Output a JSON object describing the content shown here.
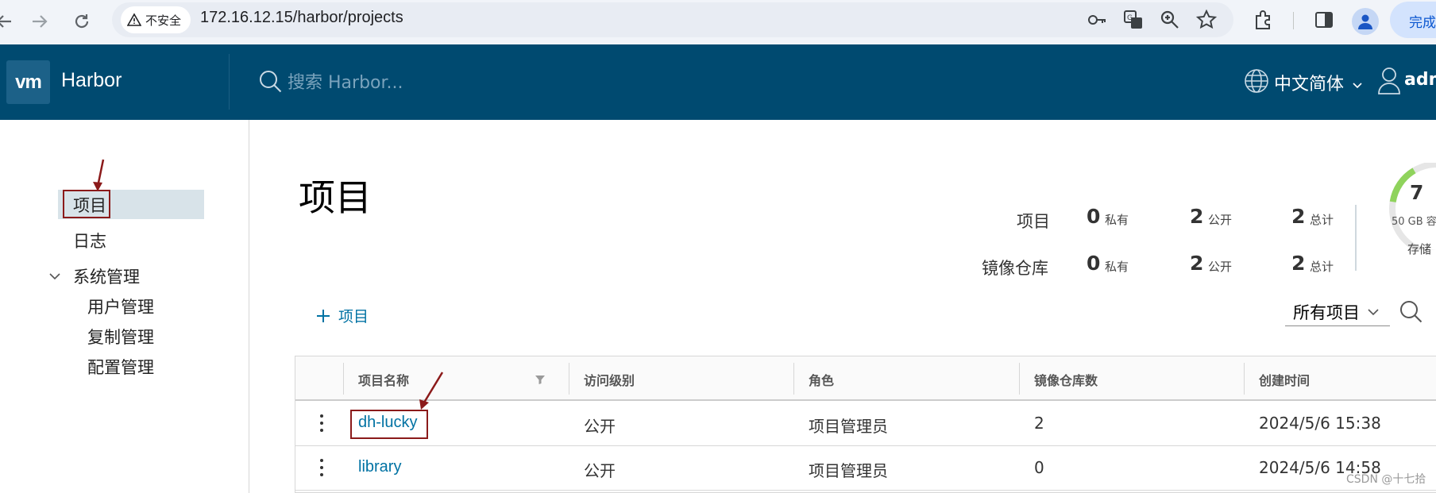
{
  "browser": {
    "security_label": "不安全",
    "url": "172.16.12.15/harbor/projects",
    "finish_label": "完成"
  },
  "header": {
    "logo_text": "vm",
    "brand": "Harbor",
    "search_placeholder": "搜索 Harbor...",
    "language": "中文简体",
    "user": "admin"
  },
  "sidebar": {
    "items": [
      {
        "label": "项目",
        "active": true
      },
      {
        "label": "日志"
      },
      {
        "label": "系统管理",
        "expanded": true,
        "children": [
          {
            "label": "用户管理"
          },
          {
            "label": "复制管理"
          },
          {
            "label": "配置管理"
          }
        ]
      }
    ]
  },
  "main": {
    "title": "项目",
    "summary": {
      "rows": [
        {
          "label": "项目",
          "private": "0",
          "public": "2",
          "total": "2"
        },
        {
          "label": "镜像仓库",
          "private": "0",
          "public": "2",
          "total": "2"
        }
      ],
      "private_unit": "私有",
      "public_unit": "公开",
      "total_unit": "总计"
    },
    "storage": {
      "value": "7",
      "capacity": "50 GB 容",
      "label": "存储",
      "used_fraction": 0.14
    },
    "add_project_label": "项目",
    "filter_selected": "所有项目",
    "table": {
      "columns": [
        "项目名称",
        "访问级别",
        "角色",
        "镜像仓库数",
        "创建时间"
      ],
      "rows": [
        {
          "name": "dh-lucky",
          "access": "公开",
          "role": "项目管理员",
          "repos": "2",
          "created": "2024/5/6 15:38"
        },
        {
          "name": "library",
          "access": "公开",
          "role": "项目管理员",
          "repos": "0",
          "created": "2024/5/6 14:58"
        }
      ]
    }
  },
  "watermark": "CSDN @十七拾",
  "colors": {
    "header_bg": "#004a70",
    "link": "#0072a3",
    "annotation": "#8b1a1a",
    "active_nav_bg": "#d8e3e9"
  }
}
